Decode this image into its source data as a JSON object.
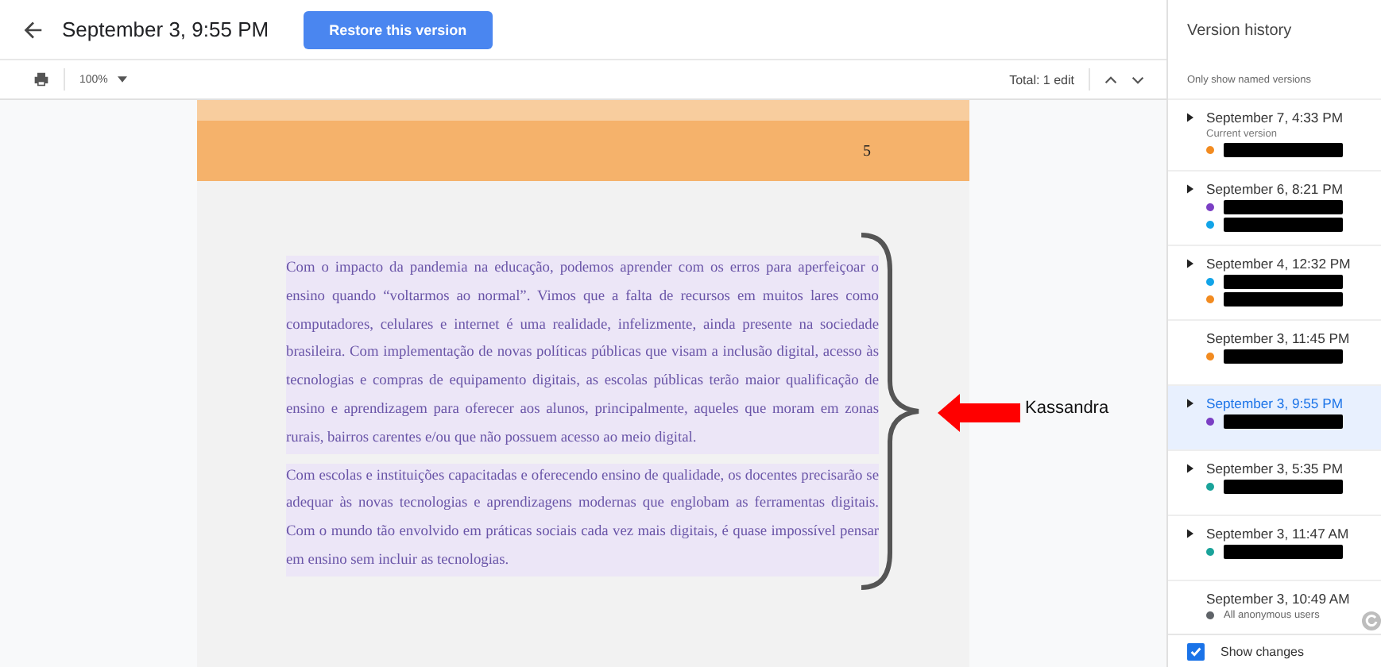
{
  "header": {
    "title": "September 3, 9:55 PM",
    "restore_button": "Restore this version"
  },
  "toolbar": {
    "zoom": "100%",
    "total": "Total: 1 edit"
  },
  "document": {
    "page_number": "5",
    "paragraphs": [
      "Com o impacto da pandemia na educação, podemos aprender com os erros para aperfeiçoar o ensino quando “voltarmos ao normal”. Vimos que a falta de recursos em muitos lares como computadores, celulares e internet é uma realidade, infelizmente, ainda presente na sociedade brasileira. Com implementação de novas políticas públicas que visam a inclusão digital, acesso às tecnologias e compras de equipamento digitais, as escolas públicas terão maior qualificação de ensino e aprendizagem para oferecer aos alunos, principalmente, aqueles que moram em zonas rurais, bairros carentes e/ou que não possuem acesso ao meio digital.",
      "Com escolas e instituições capacitadas e oferecendo ensino de qualidade, os docentes precisarão se adequar às novas tecnologias e aprendizagens modernas que englobam as ferramentas digitais. Com o mundo tão envolvido em práticas sociais cada vez mais digitais, é quase impossível pensar em ensino sem incluir as tecnologias."
    ],
    "annotation": "Kassandra"
  },
  "sidebar": {
    "title": "Version history",
    "filter": "Only show named versions",
    "versions": [
      {
        "date": "September 7, 4:33 PM",
        "selected": false,
        "expandable": true,
        "note": "Current version",
        "users": [
          {
            "color": "#f28b20",
            "redacted": true
          }
        ]
      },
      {
        "date": "September 6, 8:21 PM",
        "selected": false,
        "expandable": true,
        "users": [
          {
            "color": "#7b3fc4",
            "redacted": true
          },
          {
            "color": "#12a4e8",
            "redacted": true
          }
        ]
      },
      {
        "date": "September 4, 12:32 PM",
        "selected": false,
        "expandable": true,
        "users": [
          {
            "color": "#12a4e8",
            "redacted": true
          },
          {
            "color": "#f28b20",
            "redacted": true
          }
        ]
      },
      {
        "date": "September 3, 11:45 PM",
        "selected": false,
        "expandable": false,
        "users": [
          {
            "color": "#f28b20",
            "redacted": true
          }
        ]
      },
      {
        "date": "September 3, 9:55 PM",
        "selected": true,
        "expandable": true,
        "users": [
          {
            "color": "#7b3fc4",
            "redacted": true
          }
        ]
      },
      {
        "date": "September 3, 5:35 PM",
        "selected": false,
        "expandable": true,
        "users": [
          {
            "color": "#1aa39a",
            "redacted": true
          }
        ]
      },
      {
        "date": "September 3, 11:47 AM",
        "selected": false,
        "expandable": true,
        "users": [
          {
            "color": "#1aa39a",
            "redacted": true
          }
        ]
      },
      {
        "date": "September 3, 10:49 AM",
        "selected": false,
        "expandable": false,
        "users": [
          {
            "color": "#5f6368",
            "redacted": false,
            "name": "All anonymous users"
          }
        ]
      }
    ],
    "show_changes": {
      "label": "Show changes",
      "checked": true
    }
  }
}
